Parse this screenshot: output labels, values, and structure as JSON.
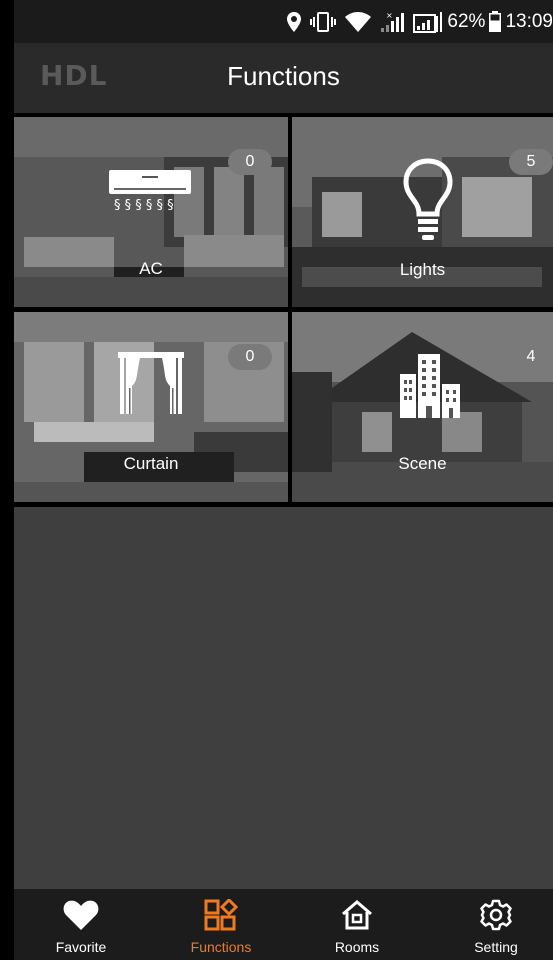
{
  "status_bar": {
    "battery_percent": "62%",
    "time": "13:09",
    "icons": [
      "location-icon",
      "vibrate-icon",
      "wifi-icon",
      "signal-no-data-icon",
      "signal-icon",
      "battery-icon"
    ]
  },
  "header": {
    "logo_text": "HDL",
    "title": "Functions"
  },
  "tiles": [
    {
      "label": "AC",
      "count": "0",
      "icon": "air-conditioner-icon"
    },
    {
      "label": "Lights",
      "count": "5",
      "icon": "light-bulb-icon"
    },
    {
      "label": "Curtain",
      "count": "0",
      "icon": "curtain-icon"
    },
    {
      "label": "Scene",
      "count": "4",
      "icon": "buildings-icon"
    }
  ],
  "tabs": [
    {
      "label": "Favorite",
      "icon": "heart-icon",
      "active": false
    },
    {
      "label": "Functions",
      "icon": "functions-icon",
      "active": true
    },
    {
      "label": "Rooms",
      "icon": "home-icon",
      "active": false
    },
    {
      "label": "Setting",
      "icon": "gear-icon",
      "active": false
    }
  ],
  "colors": {
    "accent": "#f07a22",
    "tab_bar": "#1c1c1c",
    "content_background": "#3f3f3f",
    "header": "#2a2a2a"
  }
}
